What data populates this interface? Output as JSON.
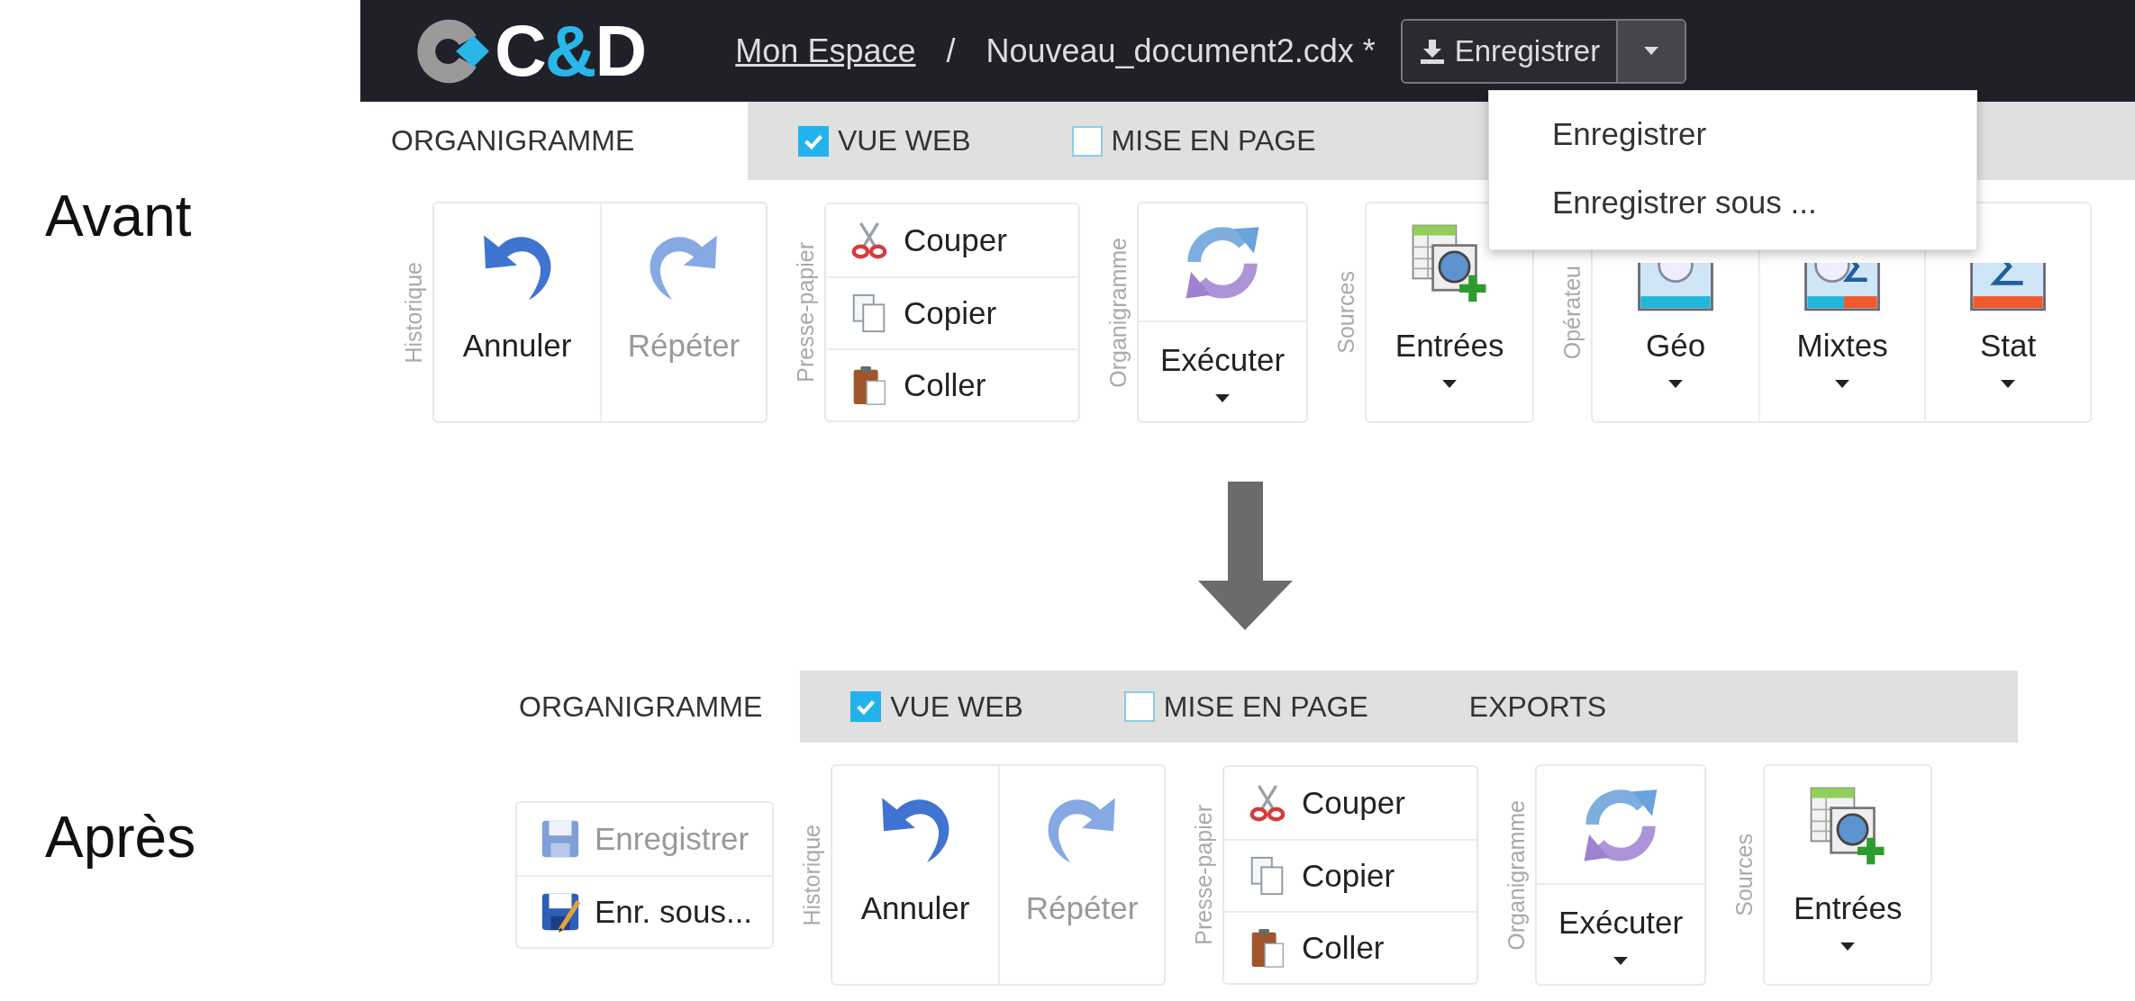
{
  "before": {
    "label": "Avant",
    "header": {
      "logo": [
        {
          "text": "C",
          "color": "#ffffff"
        },
        {
          "text": "&",
          "color": "#29b6e8"
        },
        {
          "text": "D",
          "color": "#ffffff"
        }
      ],
      "breadcrumb": [
        {
          "text": "Mon Espace",
          "kind": "link"
        },
        {
          "text": "/",
          "kind": "separator"
        },
        {
          "text": "Nouveau_document2.cdx *",
          "kind": "text"
        }
      ],
      "save_button": {
        "label": "Enregistrer"
      },
      "save_menu": {
        "open": true,
        "items": [
          "Enregistrer",
          "Enregistrer sous ..."
        ]
      }
    },
    "tabs": [
      {
        "label": "ORGANIGRAMME",
        "kind": "tab",
        "selected": true
      },
      {
        "label": "VUE WEB",
        "kind": "checkbox",
        "selected": false,
        "checked": true
      },
      {
        "label": "MISE EN PAGE",
        "kind": "checkbox",
        "selected": false,
        "checked": false
      }
    ],
    "ribbon": [
      {
        "title": "Historique",
        "kind": "large",
        "buttons": [
          {
            "kind": "undo",
            "label": "Annuler",
            "disabled": false,
            "caret": false,
            "split": false
          },
          {
            "kind": "redo",
            "label": "Répéter",
            "disabled": true,
            "caret": false,
            "split": false
          }
        ]
      },
      {
        "title": "Presse-papier",
        "kind": "small",
        "buttons": [
          {
            "kind": "cut",
            "label": "Couper",
            "disabled": false
          },
          {
            "kind": "copy",
            "label": "Copier",
            "disabled": false
          },
          {
            "kind": "paste",
            "label": "Coller",
            "disabled": false
          }
        ]
      },
      {
        "title": "Organigramme",
        "kind": "large",
        "buttons": [
          {
            "kind": "run",
            "label": "Exécuter",
            "disabled": false,
            "caret": true,
            "split": true
          }
        ]
      },
      {
        "title": "Sources",
        "kind": "large",
        "buttons": [
          {
            "kind": "inputs",
            "label": "Entrées",
            "disabled": false,
            "caret": true,
            "split": false
          }
        ]
      },
      {
        "title": "Opérateu",
        "kind": "large",
        "buttons": [
          {
            "kind": "geo",
            "label": "Géo",
            "disabled": false,
            "caret": true,
            "split": false
          },
          {
            "kind": "mixed",
            "label": "Mixtes",
            "disabled": false,
            "caret": true,
            "split": false
          },
          {
            "kind": "stat",
            "label": "Stat",
            "disabled": false,
            "caret": true,
            "split": false
          }
        ]
      }
    ]
  },
  "after": {
    "label": "Après",
    "tabs": [
      {
        "label": "ORGANIGRAMME",
        "kind": "tab",
        "selected": true
      },
      {
        "label": "VUE WEB",
        "kind": "checkbox",
        "selected": false,
        "checked": true
      },
      {
        "label": "MISE EN PAGE",
        "kind": "checkbox",
        "selected": false,
        "checked": false
      },
      {
        "label": "EXPORTS",
        "kind": "tab",
        "selected": false
      }
    ],
    "ribbon": [
      {
        "kind": "small",
        "buttons": [
          {
            "kind": "save",
            "label": "Enregistrer",
            "disabled": true
          },
          {
            "kind": "save-as",
            "label": "Enr. sous...",
            "disabled": false
          }
        ]
      },
      {
        "title": "Historique",
        "kind": "large",
        "buttons": [
          {
            "kind": "undo",
            "label": "Annuler",
            "disabled": false,
            "caret": false,
            "split": false
          },
          {
            "kind": "redo",
            "label": "Répéter",
            "disabled": true,
            "caret": false,
            "split": false
          }
        ]
      },
      {
        "title": "Presse-papier",
        "kind": "small",
        "buttons": [
          {
            "kind": "cut",
            "label": "Couper",
            "disabled": false
          },
          {
            "kind": "copy",
            "label": "Copier",
            "disabled": false
          },
          {
            "kind": "paste",
            "label": "Coller",
            "disabled": false
          }
        ]
      },
      {
        "title": "Organigramme",
        "kind": "large",
        "buttons": [
          {
            "kind": "run",
            "label": "Exécuter",
            "disabled": false,
            "caret": true,
            "split": true
          }
        ]
      },
      {
        "title": "Sources",
        "kind": "large",
        "buttons": [
          {
            "kind": "inputs",
            "label": "Entrées",
            "disabled": false,
            "caret": true,
            "split": false
          }
        ]
      }
    ]
  }
}
